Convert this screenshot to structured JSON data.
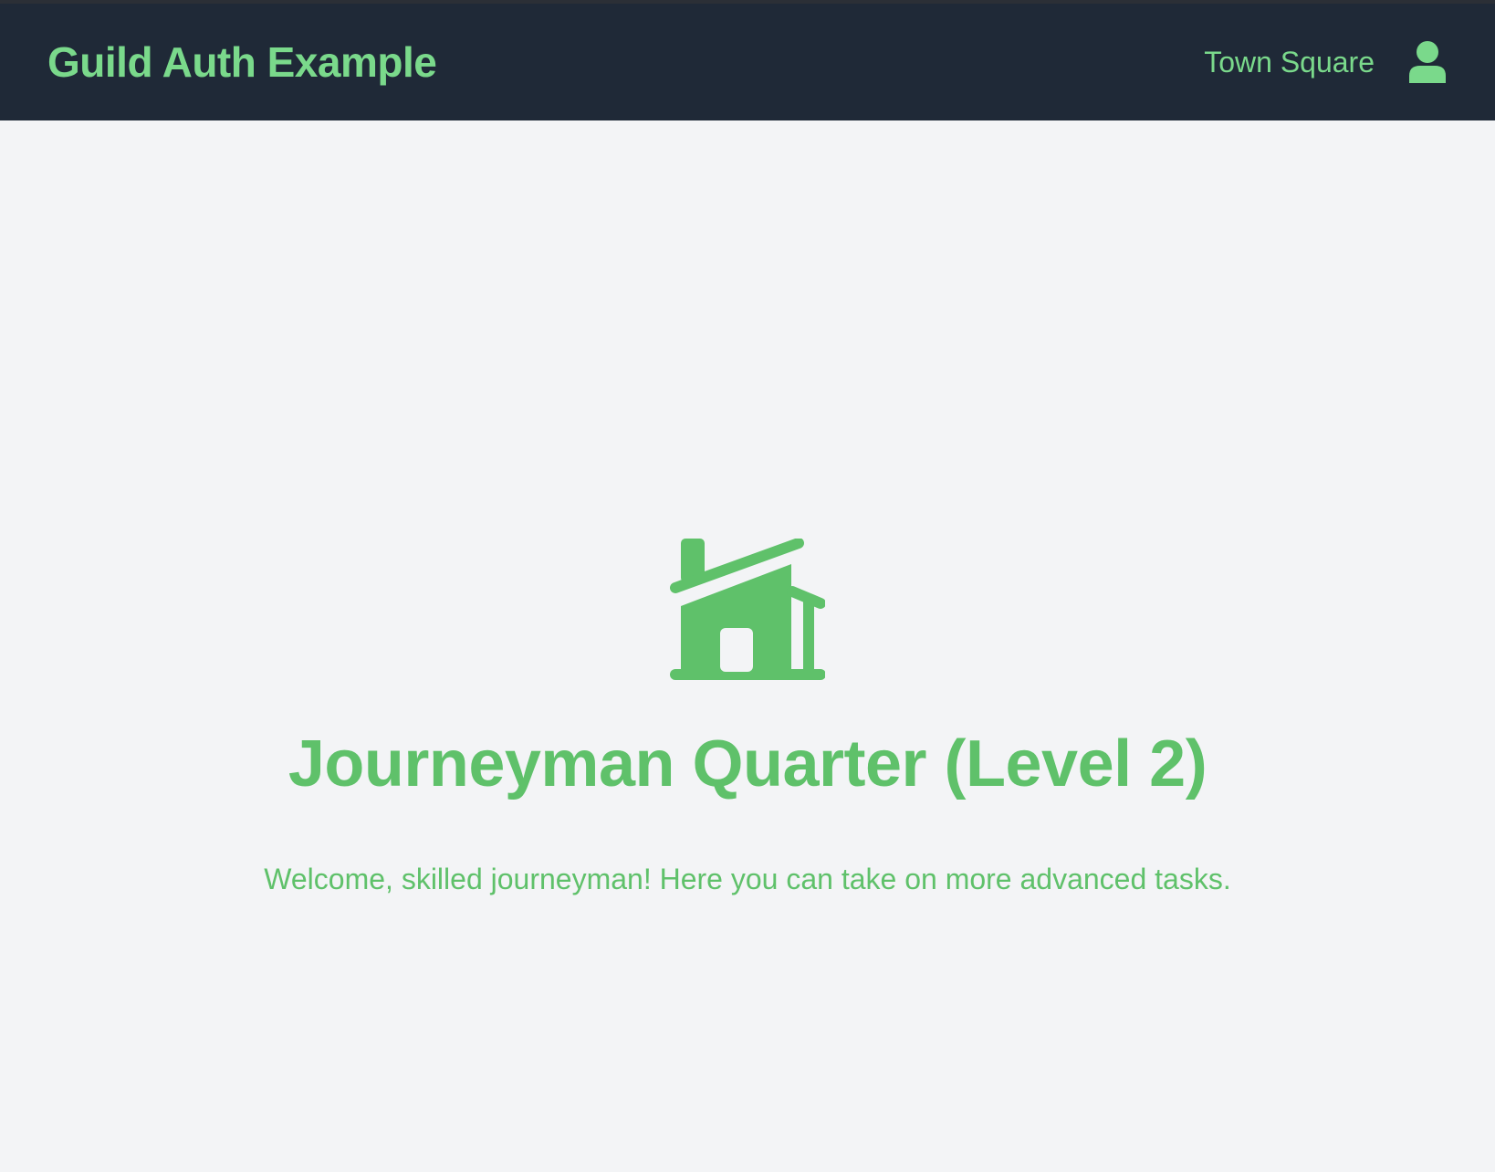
{
  "header": {
    "brand": "Guild Auth Example",
    "nav_link": "Town Square",
    "user_icon": "user-icon"
  },
  "main": {
    "icon": "house-icon",
    "title": "Journeyman Quarter (Level 2)",
    "message": "Welcome, skilled journeyman! Here you can take on more advanced tasks."
  },
  "colors": {
    "navbar_bg": "#1f2937",
    "page_bg": "#f3f4f6",
    "header_text": "#7ad98b",
    "accent_green": "#5fc16a"
  }
}
